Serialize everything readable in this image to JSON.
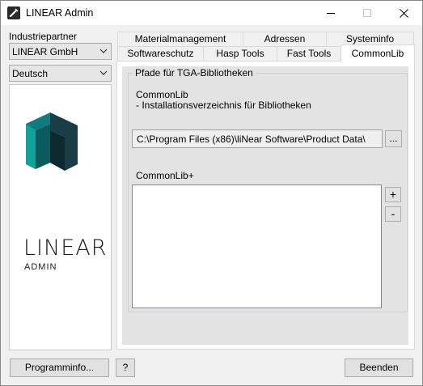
{
  "window": {
    "title": "LINEAR Admin"
  },
  "sidebar": {
    "partner_label": "Industriepartner",
    "partner_value": "LINEAR GmbH",
    "language_value": "Deutsch",
    "logo_word": "LINEAR",
    "logo_sub": "ADMIN"
  },
  "tabs": {
    "row_top": [
      "Materialmanagement",
      "Adressen",
      "Systeminfo"
    ],
    "row_bottom": [
      "Softwareschutz",
      "Hasp Tools",
      "Fast Tools",
      "CommonLib"
    ],
    "active": "CommonLib"
  },
  "commonlib": {
    "group_title": "Pfade für TGA-Bibliotheken",
    "section_title": "CommonLib",
    "section_desc": "- Installationsverzeichnis für Bibliotheken",
    "path_value": "C:\\Program Files (x86)\\liNear Software\\Product Data\\",
    "browse_label": "...",
    "plus_title": "CommonLib+",
    "add_label": "+",
    "remove_label": "-"
  },
  "footer": {
    "programinfo_label": "Programminfo...",
    "help_label": "?",
    "exit_label": "Beenden"
  }
}
